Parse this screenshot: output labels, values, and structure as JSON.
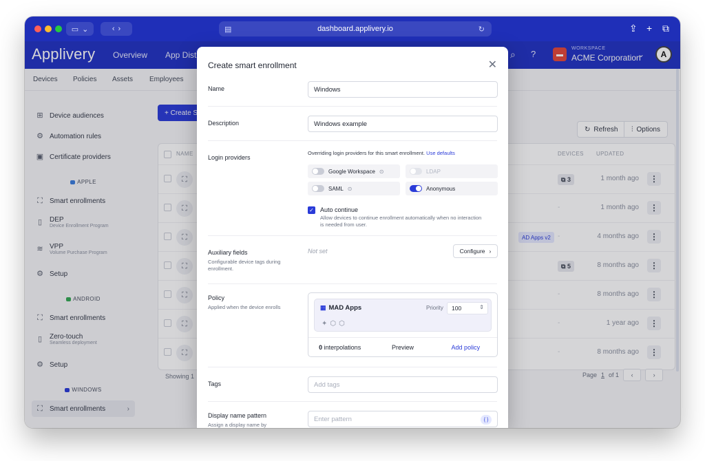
{
  "browser": {
    "url": "dashboard.applivery.io"
  },
  "app": {
    "logo": "Applivery",
    "nav": [
      "Overview",
      "App Distr"
    ],
    "workspace_label": "WORKSPACE",
    "workspace_name": "ACME Corporation"
  },
  "subnav": [
    "Devices",
    "Policies",
    "Assets",
    "Employees"
  ],
  "sidebar": {
    "items_top": [
      "Device audiences",
      "Automation rules",
      "Certificate providers"
    ],
    "apple_label": "APPLE",
    "apple_items": [
      {
        "label": "Smart enrollments",
        "sub": ""
      },
      {
        "label": "DEP",
        "sub": "Device Enrollment Program"
      },
      {
        "label": "VPP",
        "sub": "Volume Purchase Program"
      },
      {
        "label": "Setup",
        "sub": ""
      }
    ],
    "android_label": "ANDROID",
    "android_items": [
      {
        "label": "Smart enrollments",
        "sub": ""
      },
      {
        "label": "Zero-touch",
        "sub": "Seamless deployment"
      },
      {
        "label": "Setup",
        "sub": ""
      }
    ],
    "windows_label": "WINDOWS",
    "windows_items": [
      {
        "label": "Smart enrollments",
        "sub": ""
      }
    ],
    "colors": {
      "apple": "#3b7ddd",
      "android": "#34a853",
      "windows": "#2a3bd8"
    }
  },
  "main": {
    "create_label": "+ Create S",
    "refresh_label": "Refresh",
    "options_label": "Options",
    "columns": {
      "name": "NAME",
      "devices": "DEVICES",
      "updated": "UPDATED"
    },
    "rows": [
      {
        "devices": "3",
        "updated": "1 month ago",
        "tag": ""
      },
      {
        "devices": "",
        "updated": "1 month ago",
        "tag": ""
      },
      {
        "devices": "",
        "updated": "4 months ago",
        "tag": "AD Apps v2"
      },
      {
        "devices": "5",
        "updated": "8 months ago",
        "tag": ""
      },
      {
        "devices": "",
        "updated": "8 months ago",
        "tag": ""
      },
      {
        "devices": "",
        "updated": "1 year ago",
        "tag": ""
      },
      {
        "devices": "",
        "updated": "8 months ago",
        "tag": ""
      }
    ],
    "showing": "Showing 1",
    "page_label": "Page",
    "page_current": "1",
    "page_of": "of 1"
  },
  "modal": {
    "title": "Create smart enrollment",
    "name_label": "Name",
    "name_value": "Windows",
    "description_label": "Description",
    "description_value": "Windows example",
    "login_label": "Login providers",
    "login_desc": "Overriding login providers for this smart enrollment.",
    "login_link": "Use defaults",
    "providers": [
      {
        "name": "Google Workspace",
        "state": "off"
      },
      {
        "name": "LDAP",
        "state": "disabled"
      },
      {
        "name": "SAML",
        "state": "off"
      },
      {
        "name": "Anonymous",
        "state": "on"
      }
    ],
    "auto_continue_title": "Auto continue",
    "auto_continue_desc": "Allow devices to continue enrollment automatically when no interaction is needed from user.",
    "aux_label": "Auxiliary fields",
    "aux_help": "Configurable device tags during enrollment.",
    "aux_value": "Not set",
    "configure_label": "Configure",
    "policy_label": "Policy",
    "policy_help": "Applied when the device enrolls",
    "policy_name": "MAD Apps",
    "priority_label": "Priority",
    "priority_value": "100",
    "interpolations_count": "0",
    "interpolations_label": "interpolations",
    "preview_label": "Preview",
    "add_policy_label": "Add policy",
    "tags_label": "Tags",
    "tags_placeholder": "Add tags",
    "display_label": "Display name pattern",
    "display_help": "Assign a display name by",
    "display_placeholder": "Enter pattern"
  }
}
